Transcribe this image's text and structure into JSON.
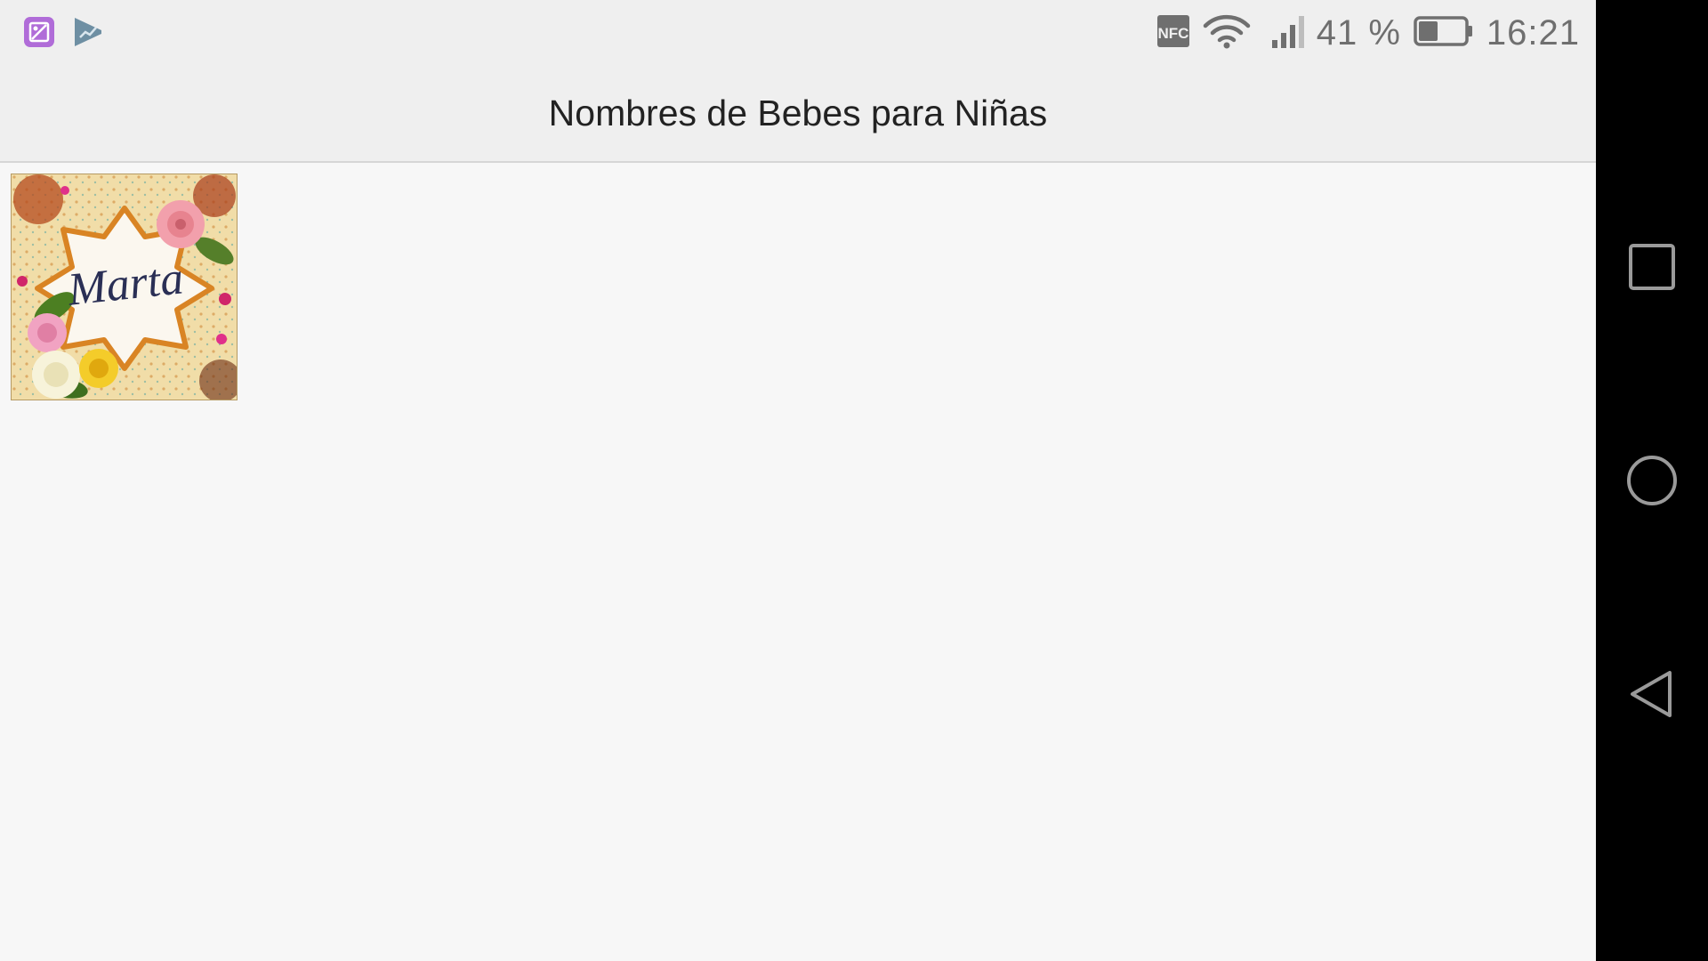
{
  "status_bar": {
    "nfc_label": "NFC",
    "battery_percent_text": "41 %",
    "battery_level": 0.41,
    "time": "16:21"
  },
  "toolbar": {
    "title": "Nombres de Bebes para Niñas"
  },
  "gallery": {
    "items": [
      {
        "name_text": "Marta"
      }
    ]
  },
  "nav_bar": {
    "icons": [
      "recents-square-icon",
      "home-circle-icon",
      "back-triangle-icon"
    ]
  },
  "colors": {
    "status_bg": "#efefef",
    "content_bg": "#f7f7f7",
    "nav_bg": "#000000",
    "notification_icon_purple": "#b06cd8"
  }
}
